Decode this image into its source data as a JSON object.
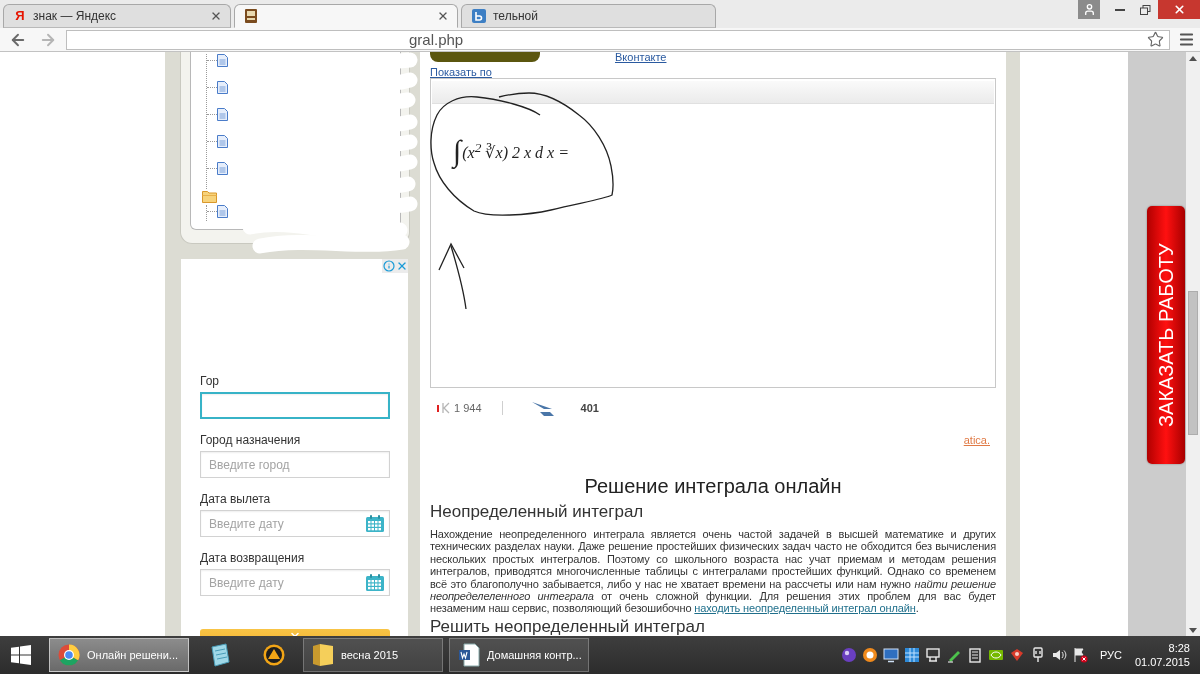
{
  "browser": {
    "tabs": [
      {
        "kind": "letter",
        "icon_text": "Я",
        "title": "знак — Яндекс",
        "selected": false,
        "closable": true
      },
      {
        "kind": "book",
        "selected": true,
        "closable": true
      },
      {
        "kind": "tile",
        "title": "тельной",
        "selected": false,
        "closable": false
      }
    ],
    "address": "gral.php"
  },
  "sidebar": {
    "tree": [
      {
        "kind": "doc"
      },
      {
        "kind": "doc"
      },
      {
        "kind": "doc"
      },
      {
        "kind": "doc"
      },
      {
        "kind": "doc"
      },
      {
        "kind": "folder",
        "children": [
          {
            "kind": "doc"
          }
        ]
      }
    ],
    "ad": {
      "fields": [
        {
          "label": "Гор",
          "kind": "text",
          "focused": true
        },
        {
          "label": "Город назначения",
          "placeholder": "Введите город",
          "kind": "text",
          "focused": false
        },
        {
          "label": "Дата вылета",
          "placeholder": "Введите дату",
          "kind": "date",
          "focused": false
        },
        {
          "label": "Дата возвращения",
          "placeholder": "Введите дату",
          "kind": "date",
          "focused": false
        }
      ]
    }
  },
  "content": {
    "vk_link": "Вконтакте",
    "show_link": "Показать по",
    "formula": {
      "sign": "∫",
      "body": "(x$^{2}$ ∛x) 2 x d x ="
    },
    "counters": [
      {
        "kind": "views",
        "value": "1 944"
      },
      {
        "kind": "shares",
        "value": "401"
      }
    ],
    "notice_link": "atica.",
    "title": "Решение интеграла онлайн",
    "sections": [
      {
        "heading": "Неопределенный интеграл",
        "paragraph": {
          "text": "Нахождение неопределенного интеграла является очень частой задачей в высшей математике и других технических разделах науки. Даже решение простейших физических задач часто не обходится без вычисления нескольких простых интегралов. Поэтому со школьного возраста нас учат приемам и методам решения интегралов, приводятся многочисленные таблицы с интегралами простейших функций. Однако со временем всё это благополучно забывается, либо у нас не хватает времени на рассчеты или нам нужно *найти решение неопределеленного интеграла* от очень сложной функции. Для решения этих проблем для вас будет незаменим наш сервис, позволяющий безошибочно",
          "link": "находить неопределенный интеграл онлайн",
          "end": "."
        }
      },
      {
        "heading": "Решить неопределенный интеграл"
      }
    ]
  },
  "order_button": "ЗАКАЗАТЬ РАБОТУ",
  "taskbar": {
    "apps": [
      {
        "kind": "browser",
        "title": "Онлайн решени...",
        "selected": true
      },
      {
        "kind": "notes",
        "selected": false
      },
      {
        "kind": "player",
        "selected": false
      },
      {
        "kind": "folder",
        "title": "весна 2015",
        "selected": false
      },
      {
        "kind": "document",
        "title": "Домашняя контр...",
        "selected": false
      }
    ],
    "language": "РУС",
    "time": "8:28",
    "date": "01.07.2015"
  }
}
